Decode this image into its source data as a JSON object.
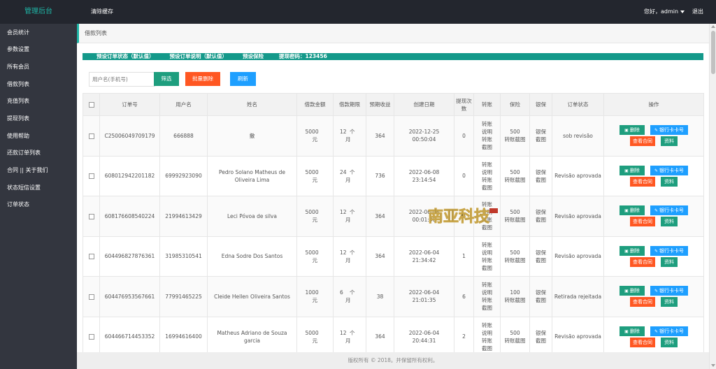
{
  "header": {
    "brand": "管理后台",
    "clear_cache": "清除缓存",
    "greeting": "您好，admin",
    "logout": "退出"
  },
  "sidebar": {
    "items": [
      {
        "label": "会员统计"
      },
      {
        "label": "参数设置"
      },
      {
        "label": "所有会员"
      },
      {
        "label": "借款列表"
      },
      {
        "label": "充值列表"
      },
      {
        "label": "提现列表"
      },
      {
        "label": "使用帮助"
      },
      {
        "label": "还款订单列表"
      },
      {
        "label": "合同 || 关于我们"
      },
      {
        "label": "状态短信设置"
      },
      {
        "label": "订单状态"
      }
    ]
  },
  "breadcrumb": "借款列表",
  "notice": {
    "items": [
      "预设订单状态（默认值）",
      "预设订单说明（默认值）",
      "预设保险",
      "提现密码：123456"
    ]
  },
  "toolbar": {
    "search_placeholder": "用户名(手机号)",
    "filter_label": "筛选",
    "batch_delete_label": "批量删除",
    "refresh_label": "刷新"
  },
  "table": {
    "headers": [
      "订单号",
      "用户名",
      "姓名",
      "借款金额",
      "借款期限",
      "预期收益",
      "创建日期",
      "提现次数",
      "转账",
      "保险",
      "银保",
      "订单状态",
      "操作"
    ],
    "amount_unit": "元",
    "term_unit": "个月",
    "term_unit_a": "个",
    "term_unit_b": "月",
    "transfer_text": [
      "转账",
      "说明",
      "转账",
      "截图"
    ],
    "insurance_suffix": "转账截图",
    "bank_insurance": [
      "银保",
      "截图"
    ],
    "actions": {
      "delete": "删除",
      "bank_card": "银行卡卡号",
      "contract": "查看合同",
      "info": "资料"
    },
    "rows": [
      {
        "order_no": "C25006049709179",
        "username": "666888",
        "name": "撒",
        "amount": "5000",
        "term": "12",
        "income": "364",
        "date": "2022-12-25",
        "time": "00:50:04",
        "withdraw_count": "0",
        "insurance": "500",
        "status": "sob revisão"
      },
      {
        "order_no": "608012942201182",
        "username": "69992923090",
        "name": "Pedro Solano Matheus de Oliveira Lima",
        "amount": "5000",
        "term": "24",
        "income": "736",
        "date": "2022-06-08",
        "time": "23:14:54",
        "withdraw_count": "0",
        "insurance": "500",
        "status": "Revisão aprovada"
      },
      {
        "order_no": "608176608540224",
        "username": "21994613429",
        "name": "Leci Póvoa de silva",
        "amount": "5000",
        "term": "12",
        "income": "364",
        "date": "2022-06-08",
        "time": "00:01:00",
        "withdraw_count": "0",
        "insurance": "500",
        "status": "Revisão aprovada"
      },
      {
        "order_no": "604496827876361",
        "username": "31985310541",
        "name": "Edna Sodre Dos Santos",
        "amount": "5000",
        "term": "12",
        "income": "364",
        "date": "2022-06-04",
        "time": "21:34:42",
        "withdraw_count": "1",
        "insurance": "500",
        "status": "Revisão aprovada"
      },
      {
        "order_no": "604476953567661",
        "username": "77991465225",
        "name": "Cleide Hellen Oliveira Santos",
        "amount": "1000",
        "term": "6",
        "income": "38",
        "date": "2022-06-04",
        "time": "21:01:35",
        "withdraw_count": "6",
        "insurance": "100",
        "status": "Retirada rejeitada"
      },
      {
        "order_no": "604466714453352",
        "username": "16994616400",
        "name": "Matheus Adriano de Souza garcia",
        "amount": "5000",
        "term": "12",
        "income": "364",
        "date": "2022-06-04",
        "time": "20:44:31",
        "withdraw_count": "2",
        "insurance": "500",
        "status": "Revisão aprovada"
      }
    ]
  },
  "footer": "版权所有 © 2018。并保留所有权利。",
  "watermark_text": "南亚科技",
  "colors": {
    "header_bg": "#23262e",
    "sidebar_bg": "#33363f",
    "brand": "#1fb5a6",
    "notice_bar": "#14998a",
    "btn_green": "#1e9e7e",
    "btn_orange": "#ff5722",
    "btn_blue": "#1e9fff"
  }
}
